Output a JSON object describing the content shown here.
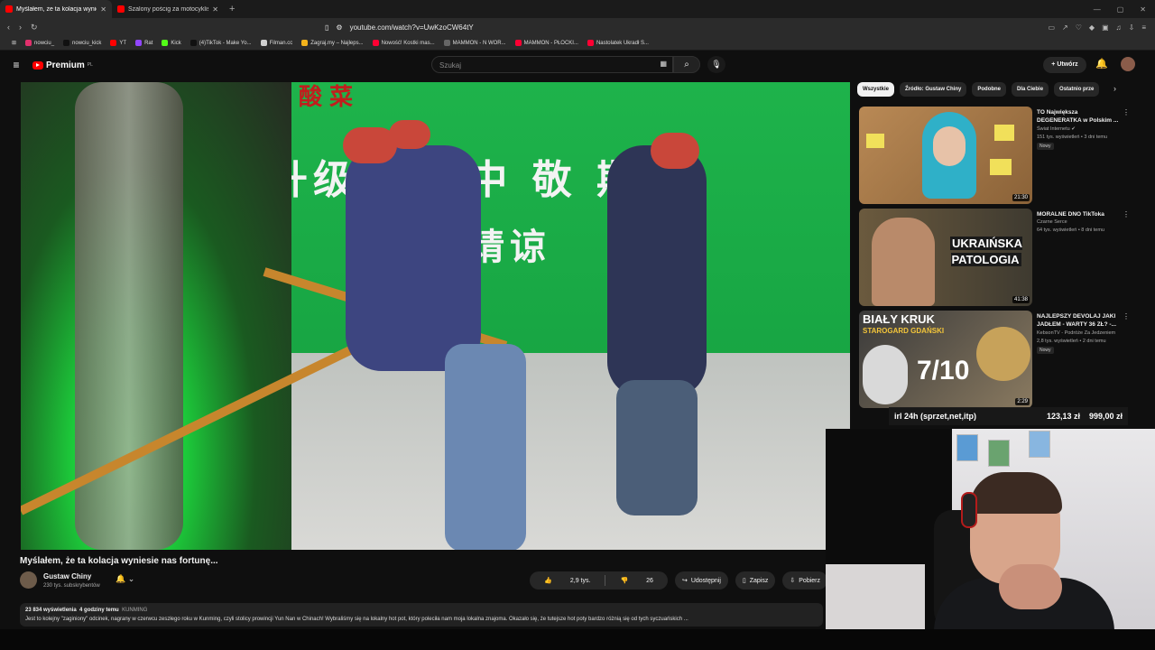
{
  "browser": {
    "tabs": [
      {
        "title": "Myślałem, że ta kolacja wynie",
        "active": true
      },
      {
        "title": "Szalony pościg za motocyklistą po m",
        "active": false
      }
    ],
    "url": "youtube.com/watch?v=UwKzoCW64tY",
    "bookmarks": [
      {
        "label": "nowciu_",
        "color": "#e1306c"
      },
      {
        "label": "nowciu_kick",
        "color": "#111111"
      },
      {
        "label": "YT",
        "color": "#ff0000"
      },
      {
        "label": "Rat",
        "color": "#9146ff"
      },
      {
        "label": "Kick",
        "color": "#53fc18"
      },
      {
        "label": "(4)TikTok - Make Yo...",
        "color": "#111111"
      },
      {
        "label": "Filman.cc",
        "color": "#d0d0d0"
      },
      {
        "label": "Zagraj.my – Najleps...",
        "color": "#f2b21b"
      },
      {
        "label": "Nowość! Kostki mas...",
        "color": "#ff0033"
      },
      {
        "label": "MAMMON - N WOR...",
        "color": "#666666"
      },
      {
        "label": "MAMMON - PŁOCKI...",
        "color": "#ff0033"
      },
      {
        "label": "Nastolatek Ukradł S...",
        "color": "#ff0033"
      }
    ]
  },
  "header": {
    "logo": "Premium",
    "logo_region": "PL",
    "search_placeholder": "Szukaj",
    "create_label": "Utwórz"
  },
  "player": {
    "sign_red": "秘制酸菜",
    "sign_line1": "升级改   行中 敬   期待",
    "sign_line2": "敬请谅"
  },
  "video": {
    "title": "Myślałem, że ta kolacja wyniesie nas fortunę...",
    "channel": "Gustaw Chiny",
    "subscribers": "230 tys. subskrybentów",
    "likes": "2,9 tys.",
    "dislikes": "26",
    "share": "Udostępnij",
    "save": "Zapisz",
    "download": "Pobierz",
    "views": "23 834 wyświetlenia",
    "published": "4 godziny temu",
    "location": "KUNMING",
    "description": "Jest to kolejny \"zaginiony\" odcinek, nagrany w czerwcu zeszłego roku w Kunming, czyli stolicy prowincji Yun Nan w Chinach! Wybraliśmy się na lokalny hot pot, który poleciła nam moja lokalna znajoma. Okazało się, że tutejsze hot poty bardzo różnią się od tych syczuańskich ..."
  },
  "sidebar": {
    "chips": [
      "Wszystkie",
      "Źródło: Gustaw Chiny",
      "Podobne",
      "Dla Ciebie",
      "Ostatnio prze"
    ],
    "recommendations": [
      {
        "title": "TO Największa DEGENERATKA w Polskim ...",
        "channel": "Świat Internetu ✔",
        "meta": "151 tys. wyświetleń • 3 dni temu",
        "badge": "Nowy",
        "duration": "21:30"
      },
      {
        "title": "MORALNE DNO TikToka",
        "channel": "Czarne Serce",
        "meta": "64 tys. wyświetleń • 8 dni temu",
        "badge": "",
        "duration": "41:38",
        "thumb_text": "UKRAIŃSKA PATOLOGIA"
      },
      {
        "title": "NAJLEPSZY DEVOLAJ JAKI JADŁEM - WARTY 36 ZŁ? -...",
        "channel": "KebsonTV - Podróże Za Jedzeniem",
        "meta": "2,8 tys. wyświetleń • 2 dni temu",
        "badge": "Nowy",
        "duration": "2:29",
        "thumb_text_1": "BIAŁY KRUK",
        "thumb_text_2": "STAROGARD GDAŃSKI",
        "thumb_text_3": "7/10"
      }
    ]
  },
  "stream_overlay": {
    "left": "irl 24h (sprzet,net,itp)",
    "mid": "123,13 zł",
    "right": "999,00 zł"
  }
}
